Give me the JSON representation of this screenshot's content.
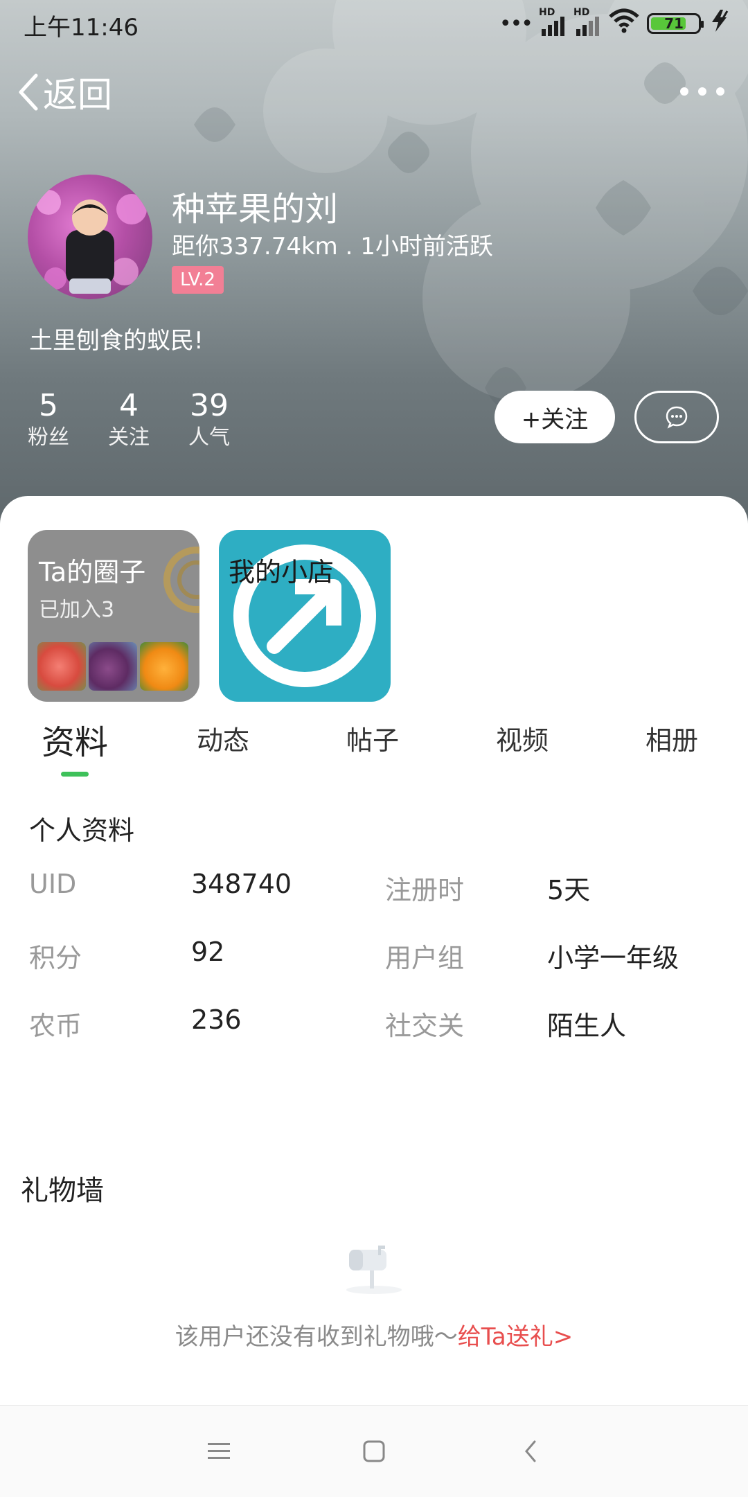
{
  "status_bar": {
    "time": "上午11:46",
    "signal_label_1": "HD",
    "signal_label_2": "HD",
    "battery": "71"
  },
  "nav": {
    "back_label": "返回"
  },
  "profile": {
    "username": "种苹果的刘",
    "meta": "距你337.74km . 1小时前活跃",
    "level": "LV.2",
    "signature": "土里刨食的蚁民!"
  },
  "stats": [
    {
      "value": "5",
      "label": "粉丝"
    },
    {
      "value": "4",
      "label": "关注"
    },
    {
      "value": "39",
      "label": "人气"
    }
  ],
  "actions": {
    "follow_label": "+关注"
  },
  "cards": {
    "circle_title": "Ta的圈子",
    "circle_sub": "已加入3",
    "shop_title": "我的小店"
  },
  "tabs": [
    {
      "label": "资料",
      "active": true
    },
    {
      "label": "动态",
      "active": false
    },
    {
      "label": "帖子",
      "active": false
    },
    {
      "label": "视频",
      "active": false
    },
    {
      "label": "相册",
      "active": false
    }
  ],
  "info": {
    "section_title": "个人资料",
    "rows": [
      {
        "k1": "UID",
        "v1": "348740",
        "k2": "注册时",
        "v2": "5天"
      },
      {
        "k1": "积分",
        "v1": "92",
        "k2": "用户组",
        "v2": "小学一年级"
      },
      {
        "k1": "农币",
        "v1": "236",
        "k2": "社交关",
        "v2": "陌生人"
      }
    ]
  },
  "gift": {
    "title": "礼物墙",
    "empty_text": "该用户还没有收到礼物哦～",
    "link_text": "给Ta送礼>"
  },
  "colors": {
    "accent_green": "#3ec15a",
    "level_badge": "#f27f95",
    "gift_link": "#e84e4e",
    "shop_card": "#2eaec3",
    "circle_card": "#8e8e8e"
  },
  "icons": [
    "back-chevron-icon",
    "more-icon",
    "message-icon",
    "mailbox-icon",
    "menu-icon",
    "home-square-icon",
    "back-triangle-icon"
  ]
}
